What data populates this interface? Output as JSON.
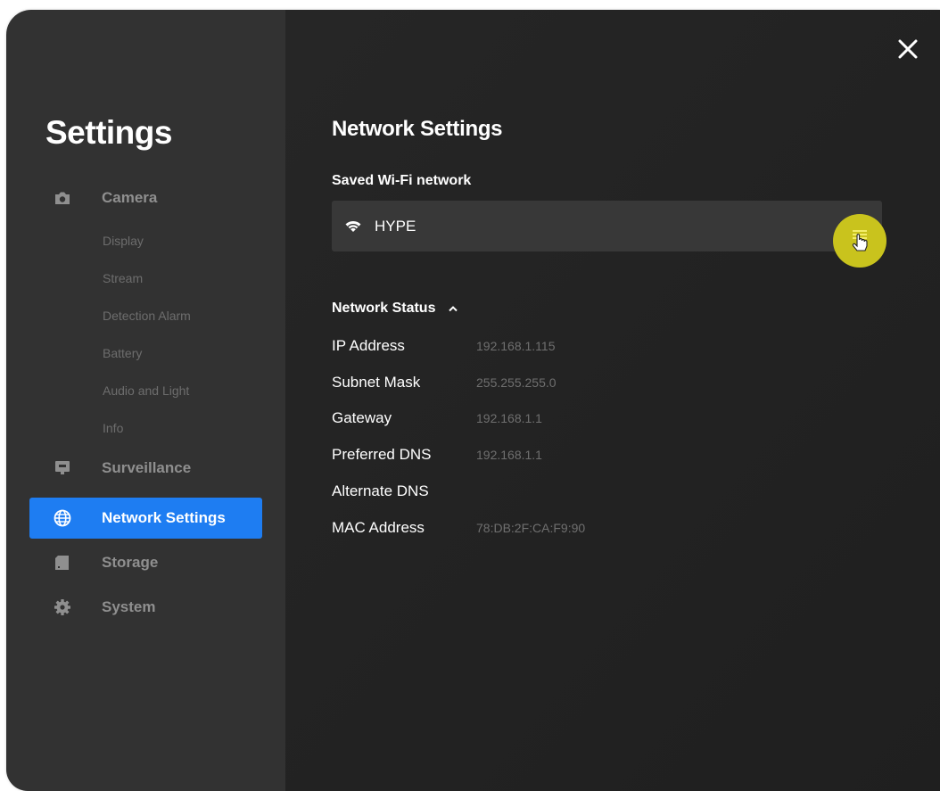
{
  "sidebar": {
    "title": "Settings",
    "sections": {
      "camera": {
        "label": "Camera",
        "icon": "camera-icon",
        "subitems": [
          "Display",
          "Stream",
          "Detection Alarm",
          "Battery",
          "Audio and Light",
          "Info"
        ]
      },
      "surveillance": {
        "label": "Surveillance",
        "icon": "monitor-icon"
      },
      "network": {
        "label": "Network Settings",
        "icon": "globe-icon",
        "active": true
      },
      "storage": {
        "label": "Storage",
        "icon": "sd-card-icon"
      },
      "system": {
        "label": "System",
        "icon": "gear-icon"
      }
    }
  },
  "main": {
    "title": "Network Settings",
    "saved_wifi": {
      "heading": "Saved Wi-Fi network",
      "network_name": "HYPE",
      "icon": "wifi-icon",
      "menu_icon": "menu-icon"
    },
    "network_status": {
      "heading": "Network Status",
      "expanded": true,
      "rows": [
        {
          "label": "IP Address",
          "value": "192.168.1.115"
        },
        {
          "label": "Subnet Mask",
          "value": "255.255.255.0"
        },
        {
          "label": "Gateway",
          "value": "192.168.1.1"
        },
        {
          "label": "Preferred DNS",
          "value": "192.168.1.1"
        },
        {
          "label": "Alternate DNS",
          "value": ""
        },
        {
          "label": "MAC Address",
          "value": "78:DB:2F:CA:F9:90"
        }
      ]
    }
  },
  "colors": {
    "accent": "#1e7df2",
    "sidebar_bg": "#323232",
    "main_bg": "#232323",
    "highlight": "#c9c31d"
  }
}
